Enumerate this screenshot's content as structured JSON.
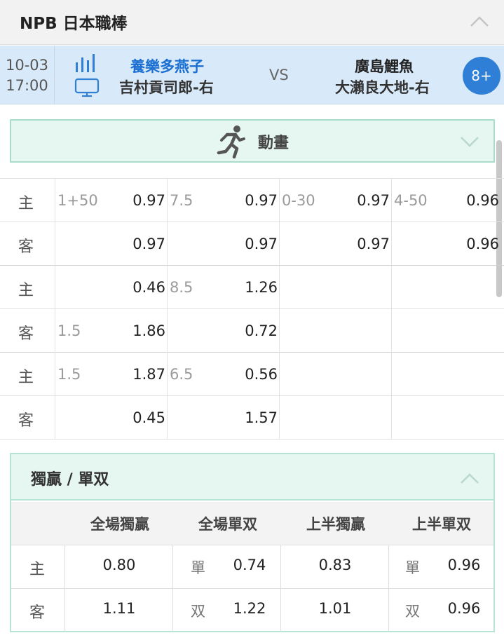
{
  "league": {
    "title": "NPB 日本職棒"
  },
  "match": {
    "date": "10-03",
    "time": "17:00",
    "home_team": "養樂多燕子",
    "home_pitcher": "吉村貢司郎-右",
    "vs": "VS",
    "away_team": "廣島鯉魚",
    "away_pitcher": "大瀨良大地-右",
    "more": "8+",
    "home_color": "#1a6fd1",
    "away_color": "#222222"
  },
  "animation": {
    "label": "動畫"
  },
  "odds_groups": [
    {
      "rows": [
        {
          "side": "主",
          "cells": [
            {
              "line": "1+50",
              "odd": "0.97"
            },
            {
              "line": "7.5",
              "odd": "0.97"
            },
            {
              "line": "0-30",
              "odd": "0.97"
            },
            {
              "line": "4-50",
              "odd": "0.96"
            }
          ]
        },
        {
          "side": "客",
          "cells": [
            {
              "line": "",
              "odd": "0.97"
            },
            {
              "line": "",
              "odd": "0.97"
            },
            {
              "line": "",
              "odd": "0.97"
            },
            {
              "line": "",
              "odd": "0.96"
            }
          ]
        }
      ]
    },
    {
      "rows": [
        {
          "side": "主",
          "cells": [
            {
              "line": "",
              "odd": "0.46"
            },
            {
              "line": "8.5",
              "odd": "1.26"
            }
          ]
        },
        {
          "side": "客",
          "cells": [
            {
              "line": "1.5",
              "odd": "1.86"
            },
            {
              "line": "",
              "odd": "0.72"
            }
          ]
        }
      ]
    },
    {
      "rows": [
        {
          "side": "主",
          "cells": [
            {
              "line": "1.5",
              "odd": "1.87"
            },
            {
              "line": "6.5",
              "odd": "0.56"
            }
          ]
        },
        {
          "side": "客",
          "cells": [
            {
              "line": "",
              "odd": "0.45"
            },
            {
              "line": "",
              "odd": "1.57"
            }
          ]
        }
      ]
    }
  ],
  "result_table": {
    "title": "獨贏 / 單双",
    "columns": [
      "全場獨贏",
      "全場單双",
      "上半獨贏",
      "上半單双"
    ],
    "rows": [
      {
        "side": "主",
        "full_win": "0.80",
        "full_oe_tag": "單",
        "full_oe": "0.74",
        "half_win": "0.83",
        "half_oe_tag": "單",
        "half_oe": "0.96"
      },
      {
        "side": "客",
        "full_win": "1.11",
        "full_oe_tag": "双",
        "full_oe": "1.22",
        "half_win": "1.01",
        "half_oe_tag": "双",
        "half_oe": "0.96"
      }
    ]
  }
}
